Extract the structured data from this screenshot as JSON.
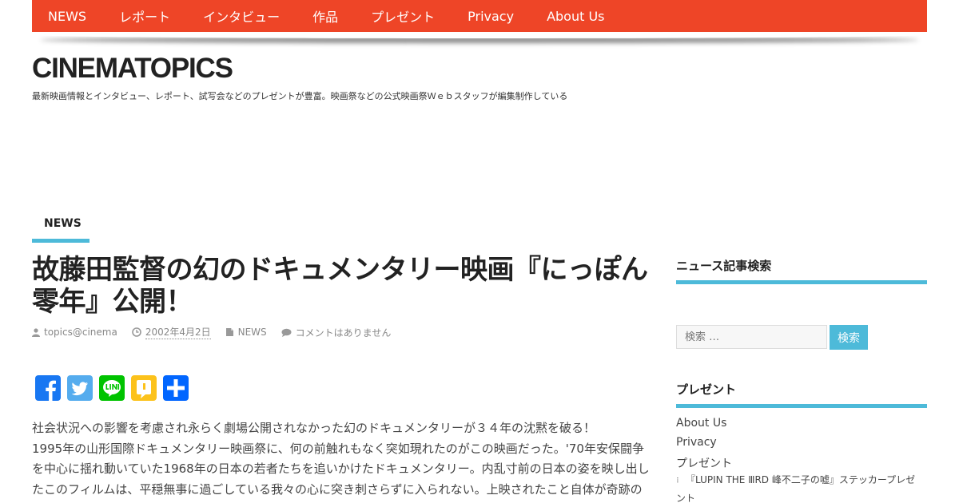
{
  "nav": {
    "items": [
      "NEWS",
      "レポート",
      "インタビュー",
      "作品",
      "プレゼント",
      "Privacy",
      "About Us"
    ]
  },
  "site": {
    "title": "CINEMATOPICS",
    "description": "最新映画情報とインタビュー、レポート、試写会などのプレゼントが豊富。映画祭などの公式映画祭Ｗｅｂスタッフが編集制作している"
  },
  "category": {
    "label": "NEWS"
  },
  "post": {
    "title": "故藤田監督の幻のドキュメンタリー映画『にっぽん零年』公開！",
    "meta": {
      "author": "topics@cinema",
      "date": "2002年4月2日",
      "category": "NEWS",
      "comments": "コメントはありません"
    },
    "body": [
      "社会状況への影響を考慮され永らく劇場公開されなかった幻のドキュメンタリーが３４年の沈黙を破る！",
      "1995年の山形国際ドキュメンタリー映画祭に、何の前触れもなく突如現れたのがこの映画だった。'70年安保闘争を中心に揺れ動いていた1968年の日本の若者たちを追いかけたドキュメンタリー。内乱寸前の日本の姿を映し出したこのフィルムは、平穏無事に過ごしている我々の心に突き刺さらずに入られない。上映されたこと自体が奇跡の"
    ]
  },
  "share": {
    "buttons": [
      "facebook-icon",
      "twitter-icon",
      "line-icon",
      "hatena-icon",
      "share-icon"
    ],
    "colors": {
      "facebook": "#1877f2",
      "twitter": "#55acee",
      "line": "#00c300",
      "hatena": "#fcc21b",
      "share": "#0166ff"
    }
  },
  "sidebar": {
    "search_title": "ニュース記事検索",
    "search_placeholder": "検索 …",
    "search_button": "検索",
    "present_title": "プレゼント",
    "links": [
      "About Us",
      "Privacy",
      "プレゼント"
    ],
    "sub_link": "『LUPIN THE ⅢRD 峰不二子の嘘』ステッカープレゼント"
  },
  "colors": {
    "nav_bg": "#ee4527",
    "accent": "#4dbad9"
  }
}
